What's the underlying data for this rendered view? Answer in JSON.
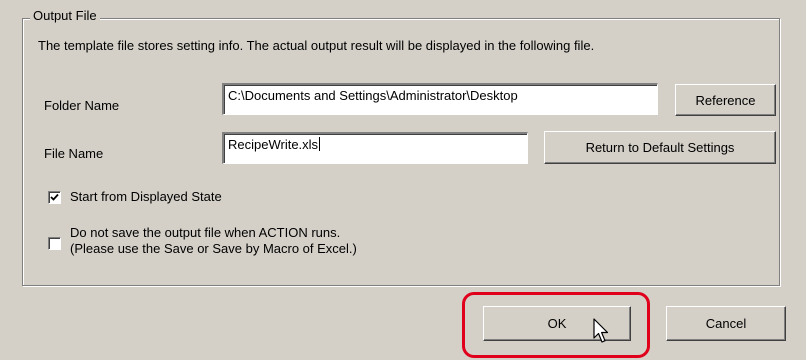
{
  "group": {
    "title": "Output File",
    "description": "The template file stores setting info. The actual output result will be displayed in the following file."
  },
  "folder": {
    "label": "Folder Name",
    "value": "C:\\Documents and Settings\\Administrator\\Desktop",
    "reference_button": "Reference"
  },
  "file": {
    "label": "File Name",
    "value": "RecipeWrite.xls",
    "default_button": "Return to Default Settings"
  },
  "options": {
    "start_from_displayed": {
      "label": "Start from Displayed State",
      "checked": true
    },
    "do_not_save": {
      "label_line1": "Do not save the output file when ACTION runs.",
      "label_line2": "(Please use the Save or Save by Macro of Excel.)",
      "checked": false
    }
  },
  "footer": {
    "ok_label": "OK",
    "cancel_label": "Cancel"
  },
  "colors": {
    "dialog_bg": "#d4d0c8",
    "highlight": "#e0001b"
  },
  "icons": [
    "check-icon",
    "mouse-pointer-icon"
  ]
}
